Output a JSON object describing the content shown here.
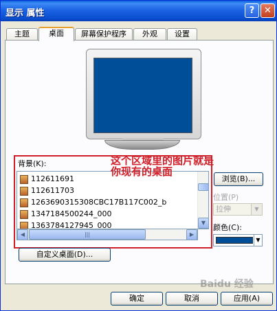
{
  "window": {
    "title": "显示 属性",
    "help": "?",
    "close": "✕"
  },
  "tabs": [
    "主题",
    "桌面",
    "屏幕保护程序",
    "外观",
    "设置"
  ],
  "background": {
    "label": "背景(K):",
    "items": [
      "112611691",
      "112611703",
      "1263690315308CBC17B117C002_b",
      "1347184500244_000",
      "1363784127945_000"
    ]
  },
  "annotation": "这个区域里的图片就是你现有的桌面",
  "controls": {
    "browse": "浏览(B)...",
    "position_label": "位置(P)",
    "position_value": "拉伸",
    "color_label": "颜色(C):",
    "color_swatch": "#004e98",
    "customize": "自定义桌面(D)..."
  },
  "buttons": {
    "ok": "确定",
    "cancel": "取消",
    "apply": "应用(A)"
  },
  "watermark": "Baidu 经验"
}
